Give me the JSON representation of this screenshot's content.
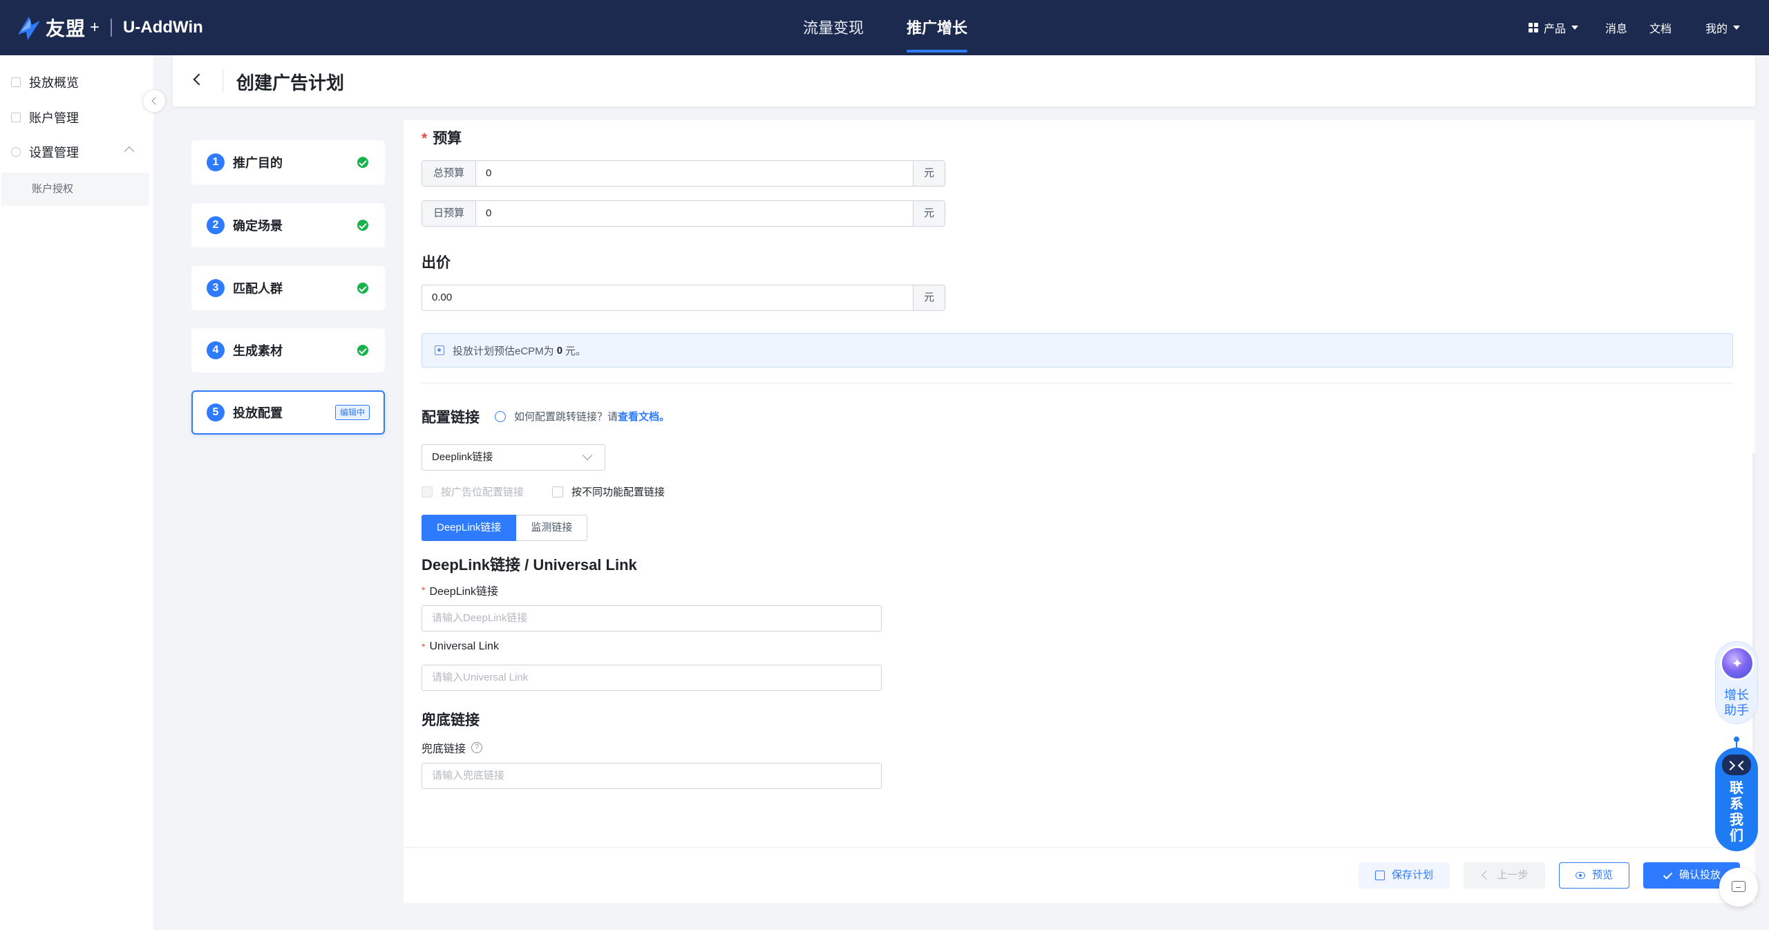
{
  "topbar": {
    "brand": "友盟",
    "brand_plus": "+",
    "product": "U-AddWin",
    "tabs": [
      {
        "label": "流量变现",
        "active": false
      },
      {
        "label": "推广增长",
        "active": true
      }
    ],
    "right": {
      "products": "产品",
      "messages": "消息",
      "docs": "文档",
      "mine": "我的"
    }
  },
  "sidebar": {
    "items": [
      {
        "label": "投放概览"
      },
      {
        "label": "账户管理"
      },
      {
        "label": "设置管理"
      }
    ],
    "sub_items": [
      {
        "label": "账户授权"
      }
    ]
  },
  "header": {
    "title": "创建广告计划"
  },
  "steps": [
    {
      "num": "1",
      "label": "推广目的",
      "status": "done"
    },
    {
      "num": "2",
      "label": "确定场景",
      "status": "done"
    },
    {
      "num": "3",
      "label": "匹配人群",
      "status": "done"
    },
    {
      "num": "4",
      "label": "生成素材",
      "status": "done"
    },
    {
      "num": "5",
      "label": "投放配置",
      "status": "editing",
      "badge": "编辑中"
    }
  ],
  "form": {
    "budget": {
      "required_mark": "*",
      "title": "预算",
      "total": {
        "prefix": "总预算",
        "value": "0",
        "suffix": "元"
      },
      "daily": {
        "prefix": "日预算",
        "value": "0",
        "suffix": "元"
      }
    },
    "bid": {
      "title": "出价",
      "value": "0.00",
      "suffix": "元"
    },
    "ecpm_info": {
      "prefix": "投放计划预估eCPM为",
      "value": "0",
      "suffix": "元。"
    },
    "link_config": {
      "title": "配置链接",
      "tip_text": "如何配置跳转链接？请",
      "tip_link": "查看文档。",
      "select_value": "Deeplink链接",
      "checkbox_by_slot": "按广告位配置链接",
      "checkbox_by_function": "按不同功能配置链接",
      "seg_active": "DeepLink链接",
      "seg_inactive": "监测链接",
      "subtitle": "DeepLink链接 / Universal Link",
      "deeplink_label": "DeepLink链接",
      "deeplink_placeholder": "请输入DeepLink链接",
      "universal_label": "Universal Link",
      "universal_placeholder": "请输入Universal Link"
    },
    "fallback": {
      "title": "兜底链接",
      "label": "兜底链接",
      "placeholder": "请输入兜底链接"
    }
  },
  "footer": {
    "save": "保存计划",
    "prev": "上一步",
    "preview": "预览",
    "confirm": "确认投放"
  },
  "floating": {
    "assistant": "增长助手",
    "contact": "联系我们"
  },
  "colors": {
    "topbar_bg": "#1b2a4e",
    "accent": "#2f7bff",
    "success": "#18b24b",
    "required": "#f54a45"
  }
}
